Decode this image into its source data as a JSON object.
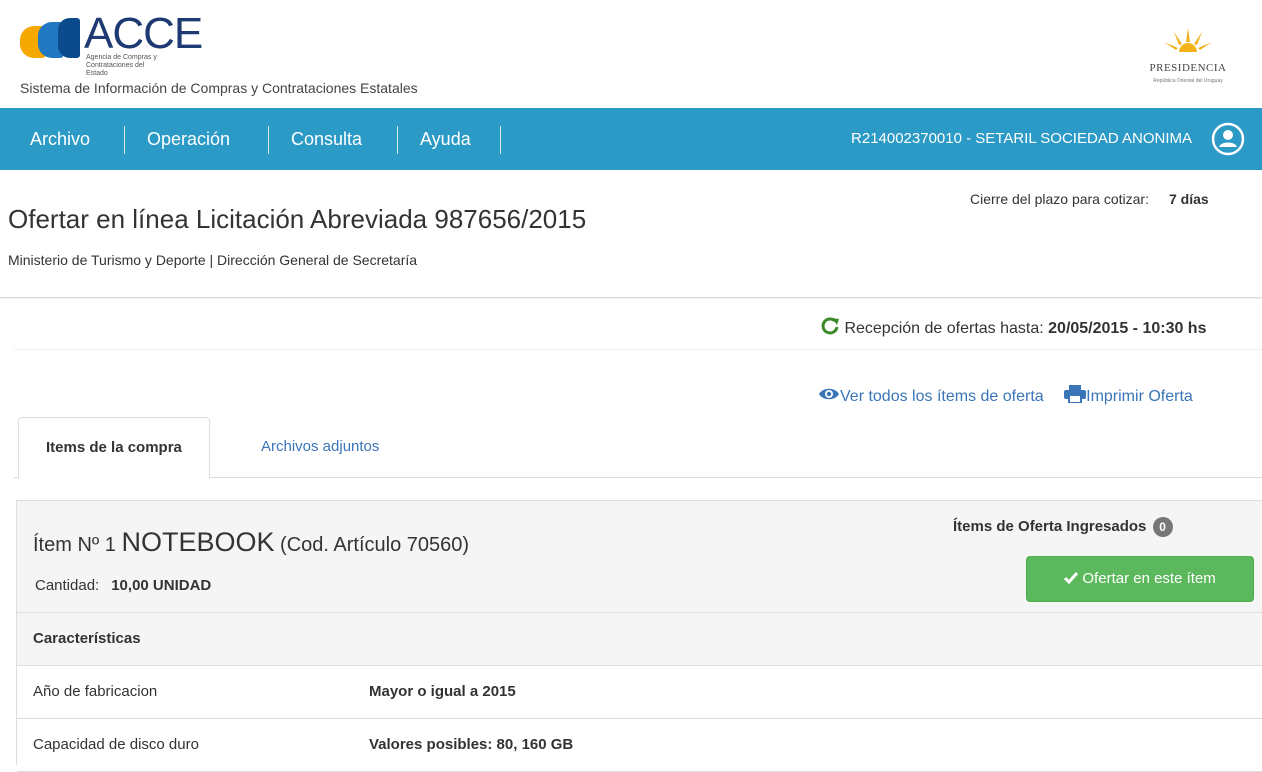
{
  "header": {
    "logo_text": "ACCE",
    "logo_subtext": "Agencia de Compras y Contrataciones del Estado",
    "system_name": "Sistema de Información de Compras y Contrataciones Estatales",
    "presidencia_title": "PRESIDENCIA",
    "presidencia_sub": "República Oriental del Uruguay"
  },
  "nav": {
    "items": [
      {
        "label": "Archivo"
      },
      {
        "label": "Operación"
      },
      {
        "label": "Consulta"
      },
      {
        "label": "Ayuda"
      }
    ],
    "user": "R214002370010 - SETARIL SOCIEDAD ANONIMA"
  },
  "page": {
    "cierre_label": "Cierre del plazo para cotizar:",
    "cierre_value": "7 días",
    "title": "Ofertar en línea Licitación Abreviada 987656/2015",
    "subtitle": "Ministerio de Turismo y Deporte | Dirección General de Secretaría",
    "recepcion_label": "Recepción de ofertas hasta:",
    "recepcion_value": "20/05/2015 - 10:30 hs",
    "ver_todos": "Ver todos los ítems de oferta",
    "imprimir": "Imprimir Oferta"
  },
  "tabs": [
    {
      "label": "Items de la compra",
      "active": true
    },
    {
      "label": "Archivos adjuntos",
      "active": false
    }
  ],
  "item": {
    "prefix": "Ítem Nº 1",
    "name": "NOTEBOOK",
    "code": "(Cod. Artículo 70560)",
    "cantidad_label": "Cantidad:",
    "cantidad_value": "10,00 UNIDAD",
    "ingresados_label": "Ítems de Oferta Ingresados",
    "ingresados_count": "0",
    "ofertar_button": "Ofertar en este ítem",
    "caracteristicas_header": "Características",
    "caracteristicas": [
      {
        "name": "Año de fabricacion",
        "value": "Mayor o igual a 2015"
      },
      {
        "name": "Capacidad de disco duro",
        "value": "Valores posibles: 80, 160 GB"
      }
    ]
  },
  "colors": {
    "nav_bg": "#2b9ac6",
    "success": "#5cb85c",
    "link": "#3a75b8"
  }
}
